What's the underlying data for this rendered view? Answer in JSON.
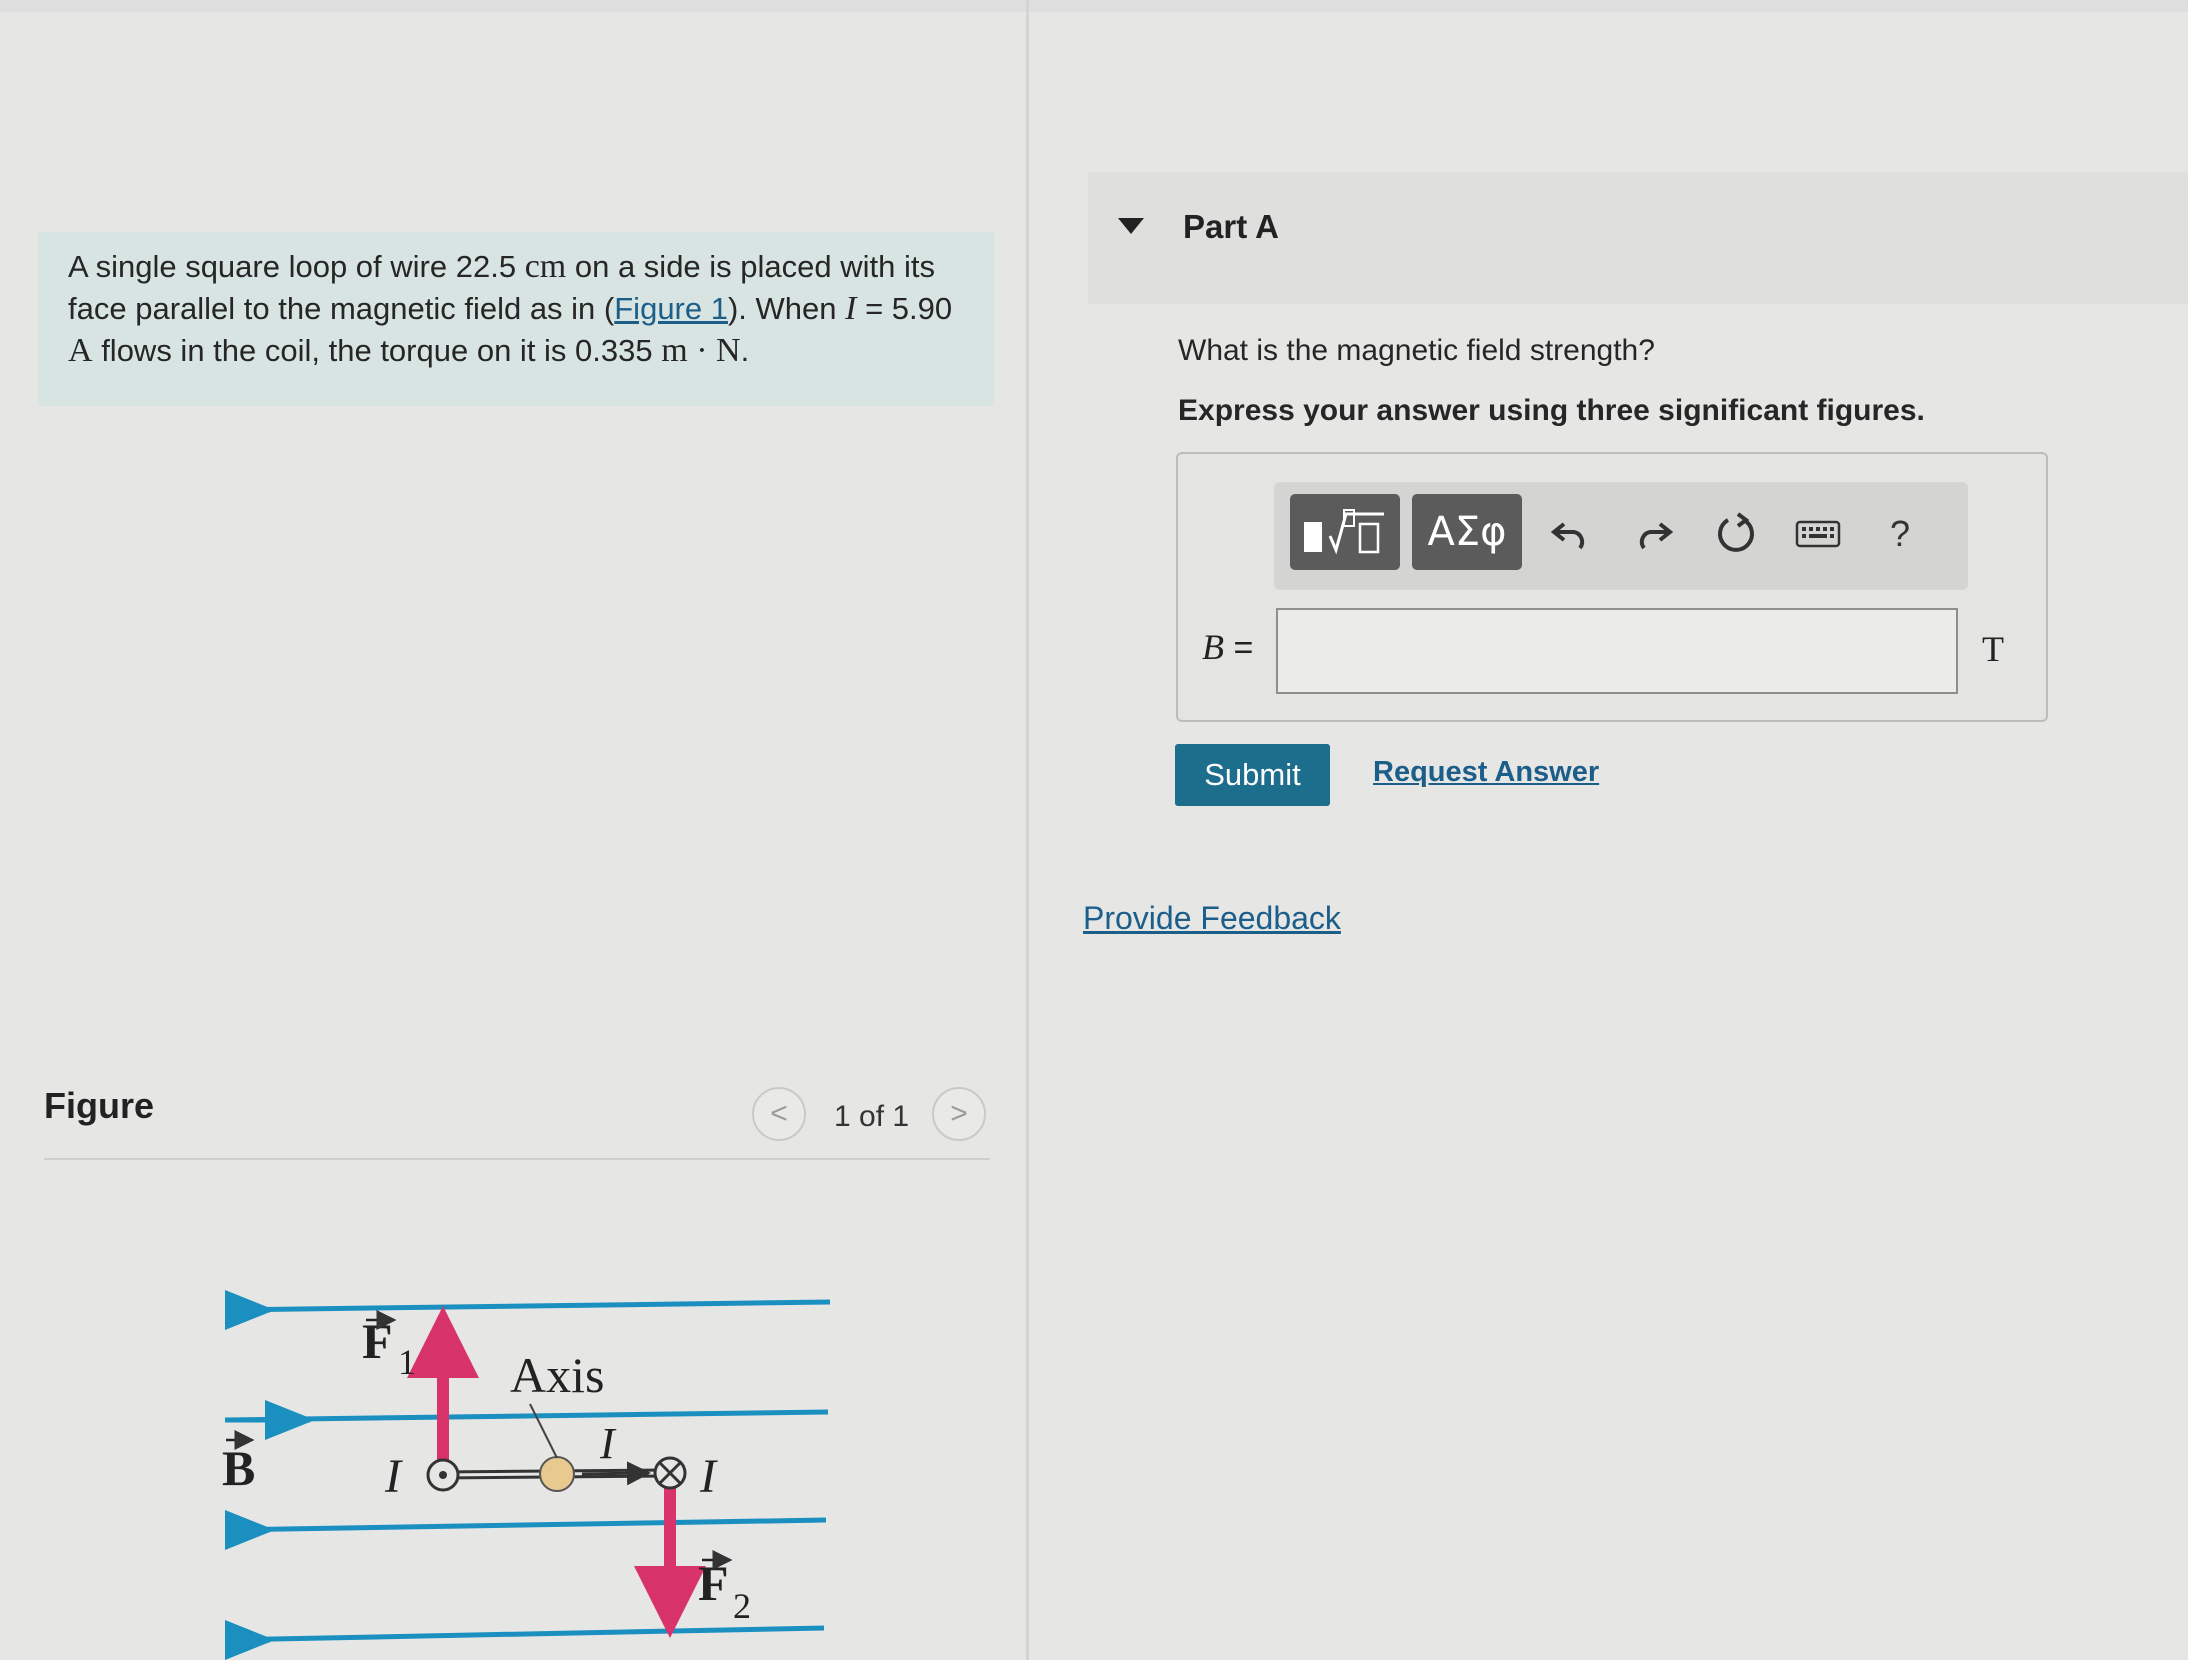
{
  "problem": {
    "text_1": "A single square loop of wire 22.5",
    "side_unit": "cm",
    "text_2": "on a side is placed with its face parallel to the magnetic field as in (",
    "figure_link": "Figure 1",
    "text_3": "). When",
    "current_symbol": "I",
    "current_eq": "= 5.90",
    "current_unit": "A",
    "text_4": "flows in the coil, the torque on it is 0.335",
    "torque_unit": "m · N",
    "text_end": "."
  },
  "figure": {
    "title": "Figure",
    "pager": "1 of 1",
    "prev_glyph": "<",
    "next_glyph": ">",
    "labels": {
      "b_field": "B",
      "f1": "F",
      "f1_sub": "1",
      "f2": "F",
      "f2_sub": "2",
      "axis": "Axis",
      "i_left": "I",
      "i_mid": "I",
      "i_right": "I"
    },
    "colors": {
      "field_lines": "#1b8fc0",
      "force_arrows": "#d8336a",
      "loop": "#333333",
      "axis_dot": "#e8c98e"
    }
  },
  "part_a": {
    "title": "Part A",
    "question": "What is the magnetic field strength?",
    "instruction": "Express your answer using three significant figures.",
    "toolbar": {
      "greek_label": "ΑΣφ",
      "help_label": "?"
    },
    "variable": "B",
    "equals": "=",
    "input_value": "",
    "unit": "T",
    "submit_label": "Submit",
    "request_label": "Request Answer"
  },
  "feedback_label": "Provide Feedback"
}
